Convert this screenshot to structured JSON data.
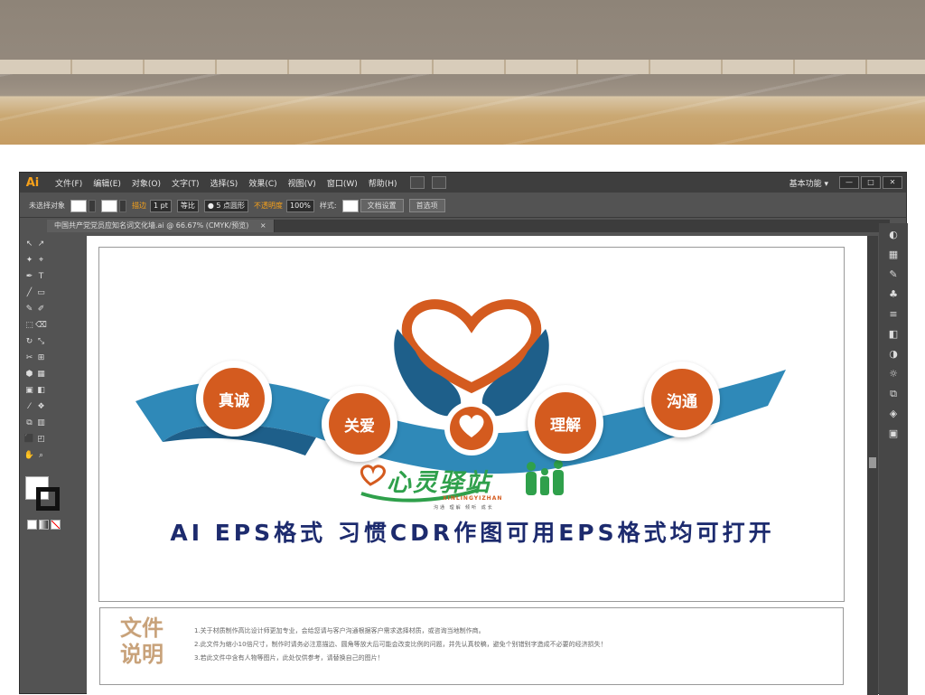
{
  "menubar": {
    "app_logo": "Ai",
    "items": [
      "文件(F)",
      "编辑(E)",
      "对象(O)",
      "文字(T)",
      "选择(S)",
      "效果(C)",
      "视图(V)",
      "窗口(W)",
      "帮助(H)"
    ],
    "workspace": "基本功能 ▾",
    "window_buttons": [
      "—",
      "□",
      "✕"
    ]
  },
  "control": {
    "selection": "未选择对象",
    "stroke_label": "描边",
    "stroke_width": "1 pt",
    "profile": "等比",
    "brush": "● 5 点圆形",
    "opacity_label": "不透明度",
    "opacity": "100%",
    "style_label": "样式:",
    "doc_setup": "文档设置",
    "prefs": "首选项"
  },
  "tab": {
    "title": "中国共产党党员应知名词文化墙.ai @ 66.67% (CMYK/预览)",
    "close": "×"
  },
  "tools": [
    "↖",
    "↗",
    "✦",
    "⌖",
    "✒",
    "T",
    "╱",
    "▭",
    "✎",
    "✐",
    "⬚",
    "⌫",
    "↻",
    "⤡",
    "✂",
    "⊞",
    "⬢",
    "▦",
    "▣",
    "◧",
    "⁄",
    "❖",
    "⧉",
    "▥",
    "⬛",
    "◰",
    "✋",
    "⌕"
  ],
  "design": {
    "circles": [
      "真诚",
      "关爱",
      "理解",
      "沟通"
    ],
    "brand": {
      "title": "心灵驿站",
      "pinyin": "XINLINGYIZHAN",
      "tags": "沟通 理解 倾听 成长"
    },
    "banner": "AI EPS格式 习惯CDR作图可用EPS格式均可打开",
    "notes_title": "文件说明",
    "notes": [
      "1.关于材质制作高比设计师更加专业，会给您请与客户沟通根据客户需求选择材质，或咨询当地制作商。",
      "2.此文件为缩小10倍尺寸，制作时请务必注意描边、圆角等放大后可能会改变比例的问题，并先认真校稿，避免个别错别字造成不必要的经济损失！",
      "3.若此文件中含有人物等图片，此处仅供参考，请替换自己的图片！"
    ]
  },
  "colors": {
    "accent_orange": "#d45b1f",
    "ribbon_blue": "#2f89b8",
    "hand_blue": "#1e5f8a",
    "brand_green": "#2fa04b",
    "banner_navy": "#1d2b6e",
    "notes_tan": "#c8a27a"
  }
}
